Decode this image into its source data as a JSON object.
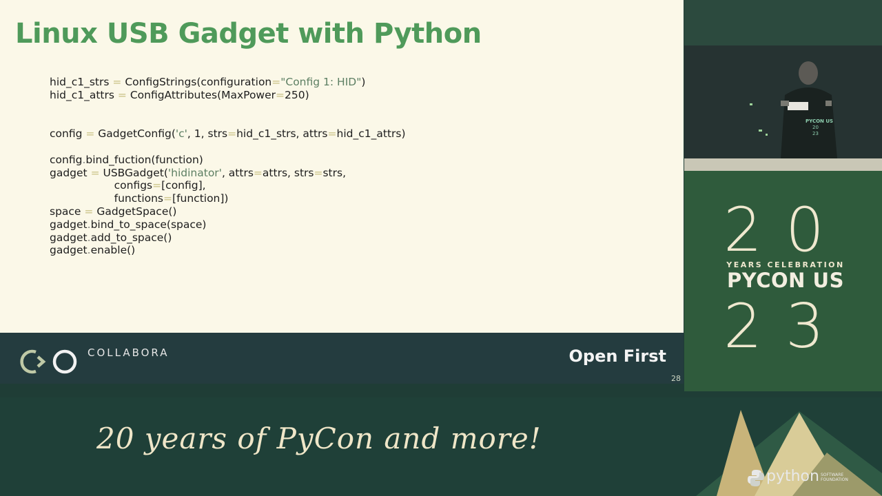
{
  "slide": {
    "title": "Linux USB Gadget with Python",
    "code_lines": [
      [
        {
          "t": "hid_c1_strs "
        },
        {
          "t": "=",
          "c": "op"
        },
        {
          "t": " ConfigStrings(configuration"
        },
        {
          "t": "=",
          "c": "op"
        },
        {
          "t": "\"Config 1: HID\"",
          "c": "str"
        },
        {
          "t": ")"
        }
      ],
      [
        {
          "t": "hid_c1_attrs "
        },
        {
          "t": "=",
          "c": "op"
        },
        {
          "t": " ConfigAttributes(MaxPower"
        },
        {
          "t": "=",
          "c": "op"
        },
        {
          "t": "250)"
        }
      ],
      [],
      [],
      [
        {
          "t": "config "
        },
        {
          "t": "=",
          "c": "op"
        },
        {
          "t": " GadgetConfig("
        },
        {
          "t": "'c'",
          "c": "str"
        },
        {
          "t": ", 1, strs"
        },
        {
          "t": "=",
          "c": "op"
        },
        {
          "t": "hid_c1_strs, attrs"
        },
        {
          "t": "=",
          "c": "op"
        },
        {
          "t": "hid_c1_attrs)"
        }
      ],
      [],
      [
        {
          "t": "config"
        },
        {
          "t": ".",
          "c": "dot"
        },
        {
          "t": "bind_fuction(function)"
        }
      ],
      [
        {
          "t": "gadget "
        },
        {
          "t": "=",
          "c": "op"
        },
        {
          "t": " USBGadget("
        },
        {
          "t": "'hidinator'",
          "c": "str"
        },
        {
          "t": ", attrs"
        },
        {
          "t": "=",
          "c": "op"
        },
        {
          "t": "attrs, strs"
        },
        {
          "t": "=",
          "c": "op"
        },
        {
          "t": "strs,"
        }
      ],
      [
        {
          "t": "                   configs"
        },
        {
          "t": "=",
          "c": "op"
        },
        {
          "t": "[config],"
        }
      ],
      [
        {
          "t": "                   functions"
        },
        {
          "t": "=",
          "c": "op"
        },
        {
          "t": "[function])"
        }
      ],
      [
        {
          "t": "space "
        },
        {
          "t": "=",
          "c": "op"
        },
        {
          "t": " GadgetSpace()"
        }
      ],
      [
        {
          "t": "gadget"
        },
        {
          "t": ".",
          "c": "dot"
        },
        {
          "t": "bind_to_space(space)"
        }
      ],
      [
        {
          "t": "gadget"
        },
        {
          "t": ".",
          "c": "dot"
        },
        {
          "t": "add_to_space()"
        }
      ],
      [
        {
          "t": "gadget"
        },
        {
          "t": ".",
          "c": "dot"
        },
        {
          "t": "enable()"
        }
      ]
    ],
    "footer": {
      "brand": "COLLABORA",
      "tagline": "Open First",
      "page_number": "28"
    }
  },
  "event": {
    "year_top": "20",
    "subtitle": "YEARS CELEBRATION",
    "name": "PYCON US",
    "year_bottom": "23",
    "shirt_text": "PYCON US",
    "shirt_year_top": "20",
    "shirt_year_bottom": "23"
  },
  "banner": {
    "slogan": "20 years of PyCon and more!",
    "sponsor_name": "python",
    "sponsor_sub": "SOFTWARE FOUNDATION"
  },
  "colors": {
    "title_green": "#4f9a5a",
    "footer_dark": "#243c3f",
    "event_green": "#2f5b3c",
    "background_dark": "#1f3d36"
  }
}
